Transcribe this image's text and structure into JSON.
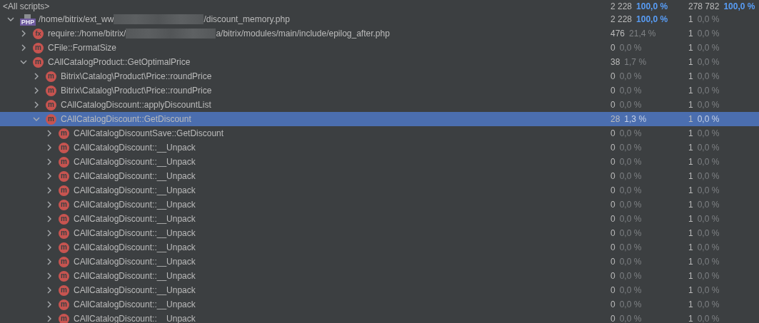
{
  "header": {
    "label": "<All scripts>",
    "count": "2 228",
    "percent": "100,0 %",
    "percent_highlight": true,
    "count2": "278 782",
    "percent2": "100,0 %",
    "percent2_highlight": true
  },
  "tree": [
    {
      "kind": "file",
      "badge": "PHP",
      "label_parts": [
        "/home/bitrix/ext_ww",
        "/discount_memory.php"
      ],
      "expanded": true,
      "selected": false,
      "count": "2 228",
      "percent": "100,0 %",
      "percent_highlight": true,
      "count2": "1",
      "percent2": "0,0 %",
      "percent2_highlight": false,
      "children": [
        {
          "kind": "function",
          "badge": "fx",
          "label_parts": [
            "require::/home/bitrix/",
            "a/bitrix/modules/main/include/epilog_after.php"
          ],
          "expanded": false,
          "selected": false,
          "count": "476",
          "percent": "21,4 %",
          "percent_highlight": false,
          "count2": "1",
          "percent2": "0,0 %",
          "percent2_highlight": false
        },
        {
          "kind": "method",
          "badge": "m",
          "label_parts": [
            "CFile::FormatSize"
          ],
          "expanded": false,
          "selected": false,
          "count": "0",
          "percent": "0,0 %",
          "percent_highlight": false,
          "count2": "1",
          "percent2": "0,0 %",
          "percent2_highlight": false
        },
        {
          "kind": "method",
          "badge": "m",
          "label_parts": [
            "CAllCatalogProduct::GetOptimalPrice"
          ],
          "expanded": true,
          "selected": false,
          "count": "38",
          "percent": "1,7 %",
          "percent_highlight": false,
          "count2": "1",
          "percent2": "0,0 %",
          "percent2_highlight": false,
          "children": [
            {
              "kind": "method",
              "badge": "m",
              "label_parts": [
                "Bitrix\\Catalog\\Product\\Price::roundPrice"
              ],
              "expanded": false,
              "selected": false,
              "count": "0",
              "percent": "0,0 %",
              "percent_highlight": false,
              "count2": "1",
              "percent2": "0,0 %",
              "percent2_highlight": false
            },
            {
              "kind": "method",
              "badge": "m",
              "label_parts": [
                "Bitrix\\Catalog\\Product\\Price::roundPrice"
              ],
              "expanded": false,
              "selected": false,
              "count": "0",
              "percent": "0,0 %",
              "percent_highlight": false,
              "count2": "1",
              "percent2": "0,0 %",
              "percent2_highlight": false
            },
            {
              "kind": "method",
              "badge": "m",
              "label_parts": [
                "CAllCatalogDiscount::applyDiscountList"
              ],
              "expanded": false,
              "selected": false,
              "count": "0",
              "percent": "0,0 %",
              "percent_highlight": false,
              "count2": "1",
              "percent2": "0,0 %",
              "percent2_highlight": false
            },
            {
              "kind": "method",
              "badge": "m",
              "label_parts": [
                "CAllCatalogDiscount::GetDiscount"
              ],
              "expanded": true,
              "selected": true,
              "count": "28",
              "percent": "1,3 %",
              "percent_highlight": false,
              "count2": "1",
              "percent2": "0,0 %",
              "percent2_highlight": false,
              "children": [
                {
                  "kind": "method",
                  "badge": "m",
                  "label_parts": [
                    "CAllCatalogDiscountSave::GetDiscount"
                  ],
                  "expanded": false,
                  "selected": false,
                  "count": "0",
                  "percent": "0,0 %",
                  "percent_highlight": false,
                  "count2": "1",
                  "percent2": "0,0 %",
                  "percent2_highlight": false
                },
                {
                  "kind": "method",
                  "badge": "m",
                  "label_parts": [
                    "CAllCatalogDiscount::__Unpack"
                  ],
                  "expanded": false,
                  "selected": false,
                  "count": "0",
                  "percent": "0,0 %",
                  "percent_highlight": false,
                  "count2": "1",
                  "percent2": "0,0 %",
                  "percent2_highlight": false
                },
                {
                  "kind": "method",
                  "badge": "m",
                  "label_parts": [
                    "CAllCatalogDiscount::__Unpack"
                  ],
                  "expanded": false,
                  "selected": false,
                  "count": "0",
                  "percent": "0,0 %",
                  "percent_highlight": false,
                  "count2": "1",
                  "percent2": "0,0 %",
                  "percent2_highlight": false
                },
                {
                  "kind": "method",
                  "badge": "m",
                  "label_parts": [
                    "CAllCatalogDiscount::__Unpack"
                  ],
                  "expanded": false,
                  "selected": false,
                  "count": "0",
                  "percent": "0,0 %",
                  "percent_highlight": false,
                  "count2": "1",
                  "percent2": "0,0 %",
                  "percent2_highlight": false
                },
                {
                  "kind": "method",
                  "badge": "m",
                  "label_parts": [
                    "CAllCatalogDiscount::__Unpack"
                  ],
                  "expanded": false,
                  "selected": false,
                  "count": "0",
                  "percent": "0,0 %",
                  "percent_highlight": false,
                  "count2": "1",
                  "percent2": "0,0 %",
                  "percent2_highlight": false
                },
                {
                  "kind": "method",
                  "badge": "m",
                  "label_parts": [
                    "CAllCatalogDiscount::__Unpack"
                  ],
                  "expanded": false,
                  "selected": false,
                  "count": "0",
                  "percent": "0,0 %",
                  "percent_highlight": false,
                  "count2": "1",
                  "percent2": "0,0 %",
                  "percent2_highlight": false
                },
                {
                  "kind": "method",
                  "badge": "m",
                  "label_parts": [
                    "CAllCatalogDiscount::__Unpack"
                  ],
                  "expanded": false,
                  "selected": false,
                  "count": "0",
                  "percent": "0,0 %",
                  "percent_highlight": false,
                  "count2": "1",
                  "percent2": "0,0 %",
                  "percent2_highlight": false
                },
                {
                  "kind": "method",
                  "badge": "m",
                  "label_parts": [
                    "CAllCatalogDiscount::__Unpack"
                  ],
                  "expanded": false,
                  "selected": false,
                  "count": "0",
                  "percent": "0,0 %",
                  "percent_highlight": false,
                  "count2": "1",
                  "percent2": "0,0 %",
                  "percent2_highlight": false
                },
                {
                  "kind": "method",
                  "badge": "m",
                  "label_parts": [
                    "CAllCatalogDiscount::__Unpack"
                  ],
                  "expanded": false,
                  "selected": false,
                  "count": "0",
                  "percent": "0,0 %",
                  "percent_highlight": false,
                  "count2": "1",
                  "percent2": "0,0 %",
                  "percent2_highlight": false
                },
                {
                  "kind": "method",
                  "badge": "m",
                  "label_parts": [
                    "CAllCatalogDiscount::__Unpack"
                  ],
                  "expanded": false,
                  "selected": false,
                  "count": "0",
                  "percent": "0,0 %",
                  "percent_highlight": false,
                  "count2": "1",
                  "percent2": "0,0 %",
                  "percent2_highlight": false
                },
                {
                  "kind": "method",
                  "badge": "m",
                  "label_parts": [
                    "CAllCatalogDiscount::__Unpack"
                  ],
                  "expanded": false,
                  "selected": false,
                  "count": "0",
                  "percent": "0,0 %",
                  "percent_highlight": false,
                  "count2": "1",
                  "percent2": "0,0 %",
                  "percent2_highlight": false
                },
                {
                  "kind": "method",
                  "badge": "m",
                  "label_parts": [
                    "CAllCatalogDiscount::__Unpack"
                  ],
                  "expanded": false,
                  "selected": false,
                  "count": "0",
                  "percent": "0,0 %",
                  "percent_highlight": false,
                  "count2": "1",
                  "percent2": "0,0 %",
                  "percent2_highlight": false
                },
                {
                  "kind": "method",
                  "badge": "m",
                  "label_parts": [
                    "CAllCatalogDiscount::__Unpack"
                  ],
                  "expanded": false,
                  "selected": false,
                  "count": "0",
                  "percent": "0,0 %",
                  "percent_highlight": false,
                  "count2": "1",
                  "percent2": "0,0 %",
                  "percent2_highlight": false
                },
                {
                  "kind": "method",
                  "badge": "m",
                  "label_parts": [
                    "CAllCatalogDiscount::__Unpack"
                  ],
                  "expanded": false,
                  "selected": false,
                  "count": "0",
                  "percent": "0,0 %",
                  "percent_highlight": false,
                  "count2": "1",
                  "percent2": "0,0 %",
                  "percent2_highlight": false
                }
              ]
            }
          ]
        }
      ]
    }
  ]
}
